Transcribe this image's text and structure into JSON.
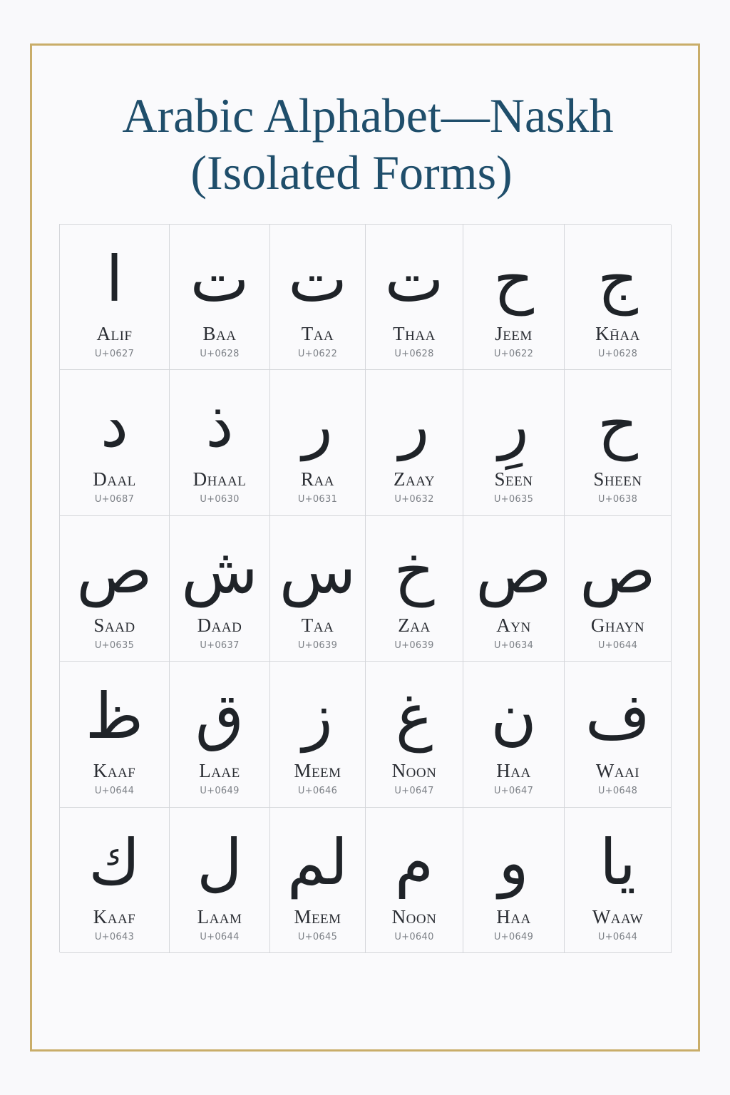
{
  "title": {
    "line1": "Arabic Alphabet—Naskh",
    "line2": "(Isolated Forms)"
  },
  "colors": {
    "frame": "#c9ad69",
    "title": "#1f4e6b",
    "glyph": "#1f2328",
    "grid": "#d4d6da"
  },
  "letters": [
    [
      {
        "glyph": "ا",
        "name": "Alif",
        "code": "U+0627"
      },
      {
        "glyph": "ت",
        "name": "Baa",
        "code": "U+0628"
      },
      {
        "glyph": "ت",
        "name": "Taa",
        "code": "U+0622"
      },
      {
        "glyph": "ت",
        "name": "Thaa",
        "code": "U+0628"
      },
      {
        "glyph": "ح",
        "name": "Jeem",
        "code": "U+0622"
      },
      {
        "glyph": "ج",
        "name": "Kh̄aa",
        "code": "U+0628"
      }
    ],
    [
      {
        "glyph": "د",
        "name": "Daal",
        "code": "U+0687"
      },
      {
        "glyph": "ذ",
        "name": "Dhaal",
        "code": "U+0630"
      },
      {
        "glyph": "ر",
        "name": "Raa",
        "code": "U+0631"
      },
      {
        "glyph": "ر",
        "name": "Zaay",
        "code": "U+0632"
      },
      {
        "glyph": "رِ",
        "name": "Seen",
        "code": "U+0635"
      },
      {
        "glyph": "ح",
        "name": "Sheen",
        "code": "U+0638"
      }
    ],
    [
      {
        "glyph": "ص",
        "name": "Saad",
        "code": "U+0635"
      },
      {
        "glyph": "ش",
        "name": "Daad",
        "code": "U+0637"
      },
      {
        "glyph": "س",
        "name": "Taa",
        "code": "U+0639"
      },
      {
        "glyph": "خ",
        "name": "Zaa",
        "code": "U+0639"
      },
      {
        "glyph": "ص",
        "name": "Ayn",
        "code": "U+0634"
      },
      {
        "glyph": "ص",
        "name": "Ghayn",
        "code": "U+0644"
      }
    ],
    [
      {
        "glyph": "ظ",
        "name": "Kaaf",
        "code": "U+0644"
      },
      {
        "glyph": "ق",
        "name": "Laae",
        "code": "U+0649"
      },
      {
        "glyph": "ز",
        "name": "Meem",
        "code": "U+0646"
      },
      {
        "glyph": "غ",
        "name": "Noon",
        "code": "U+0647"
      },
      {
        "glyph": "ن",
        "name": "Haa",
        "code": "U+0647"
      },
      {
        "glyph": "ف",
        "name": "Waai",
        "code": "U+0648"
      }
    ],
    [
      {
        "glyph": "ك",
        "name": "Kaaf",
        "code": "U+0643"
      },
      {
        "glyph": "ل",
        "name": "Laam",
        "code": "U+0644"
      },
      {
        "glyph": "لم",
        "name": "Meem",
        "code": "U+0645"
      },
      {
        "glyph": "م",
        "name": "Noon",
        "code": "U+0640"
      },
      {
        "glyph": "و",
        "name": "Haa",
        "code": "U+0649"
      },
      {
        "glyph": "يا",
        "name": "Waaw",
        "code": "U+0644"
      }
    ]
  ]
}
